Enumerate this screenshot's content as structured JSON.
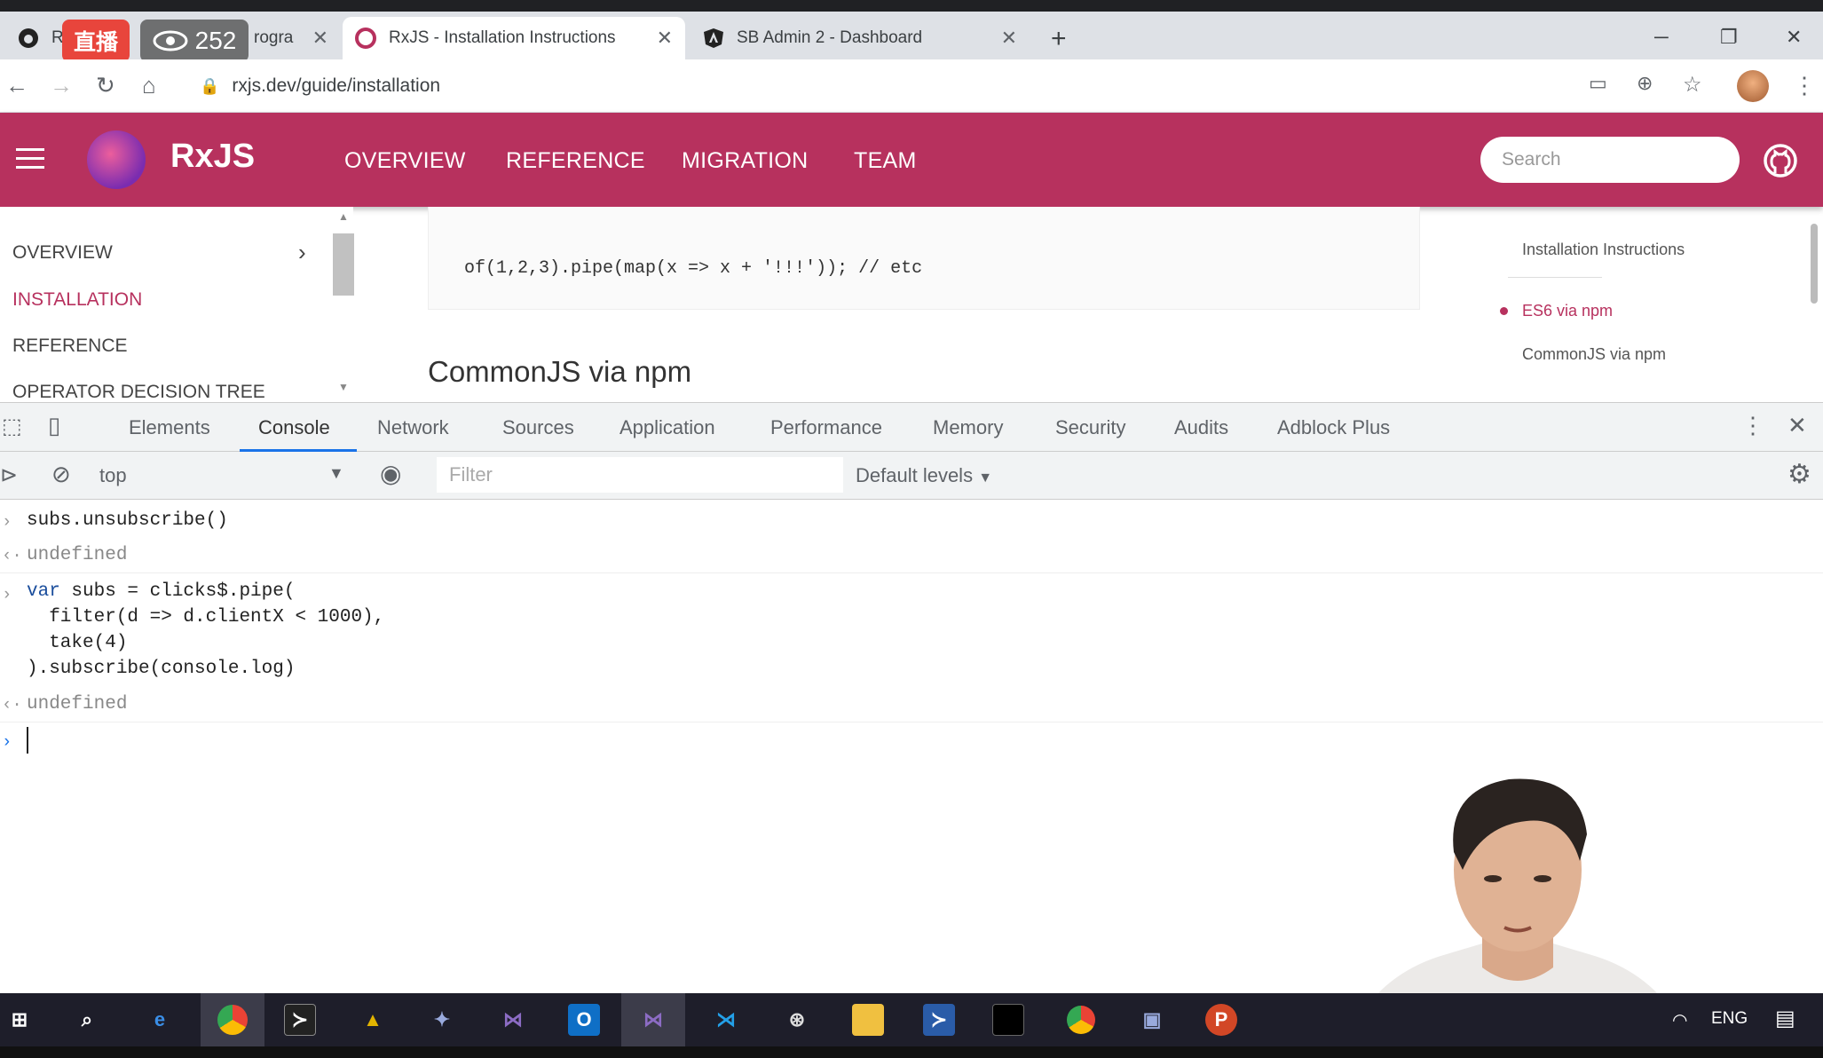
{
  "overlay": {
    "live_label": "直播",
    "viewer_count": "252"
  },
  "browser": {
    "tabs": [
      {
        "title": "Re",
        "partial_title": "rogra",
        "icon": "github-icon"
      },
      {
        "title": "RxJS - Installation Instructions",
        "icon": "rxjs-icon"
      },
      {
        "title": "SB Admin 2 - Dashboard",
        "icon": "angular-icon"
      }
    ],
    "url": "rxjs.dev/guide/installation"
  },
  "site": {
    "brand": "RxJS",
    "nav": [
      "OVERVIEW",
      "REFERENCE",
      "MIGRATION",
      "TEAM"
    ],
    "search_placeholder": "Search"
  },
  "sidebar": {
    "items": [
      {
        "label": "OVERVIEW",
        "active": false
      },
      {
        "label": "INSTALLATION",
        "active": true
      },
      {
        "label": "REFERENCE",
        "active": false
      },
      {
        "label": "OPERATOR DECISION TREE",
        "active": false
      }
    ]
  },
  "content": {
    "code_line": "of(1,2,3).pipe(map(x => x + '!!!')); // etc",
    "heading": "CommonJS via npm"
  },
  "toc": {
    "title": "Installation Instructions",
    "items": [
      {
        "label": "ES6 via npm",
        "active": true
      },
      {
        "label": "CommonJS via npm",
        "active": false
      }
    ]
  },
  "devtools": {
    "tabs": [
      "Elements",
      "Console",
      "Network",
      "Sources",
      "Application",
      "Performance",
      "Memory",
      "Security",
      "Audits",
      "Adblock Plus"
    ],
    "active_tab": "Console",
    "context": "top",
    "filter_placeholder": "Filter",
    "levels": "Default levels"
  },
  "console": {
    "line1_input": "subs.unsubscribe()",
    "line1_output": "undefined",
    "line2_kw": "var",
    "line2_rest": " subs = clicks$.pipe(",
    "line3": "  filter(d => d.clientX < 1000),",
    "line4": "  take(4)",
    "line5": ").subscribe(console.log)",
    "line2_output": "undefined"
  },
  "taskbar": {
    "lang": "ENG"
  },
  "colors": {
    "brand": "#b7315e",
    "devtools_accent": "#1a73e8"
  }
}
